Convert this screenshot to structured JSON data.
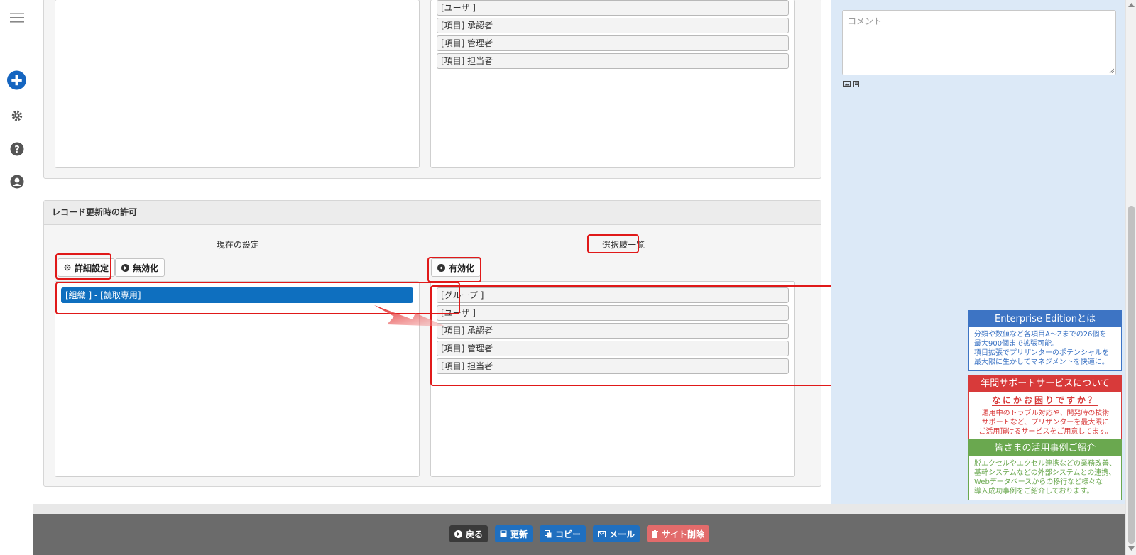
{
  "rail": {
    "icons": [
      "menu-icon",
      "add-icon",
      "gear-icon",
      "help-icon",
      "user-icon"
    ]
  },
  "top_section": {
    "options": [
      "[ユーザ ]",
      "[項目] 承認者",
      "[項目] 管理者",
      "[項目] 担当者"
    ]
  },
  "update_permission": {
    "title": "レコード更新時の許可",
    "current": {
      "heading": "現在の設定",
      "detail_button": "詳細設定",
      "disable_button": "無効化",
      "items": [
        "[組織 ] - [読取専用]"
      ]
    },
    "choices": {
      "heading": "選択肢一覧",
      "enable_button": "有効化",
      "items": [
        "[グループ ]",
        "[ユーザ ]",
        "[項目] 承認者",
        "[項目] 管理者",
        "[項目] 担当者"
      ]
    }
  },
  "side": {
    "comment_placeholder": "コメント",
    "ads": [
      {
        "title": "Enterprise Editionとは",
        "lines": [
          "分類や数値など各項目A～Zまでの26個を",
          "最大900個まで拡張可能。",
          "項目拡張でプリザンターのポテンシャルを",
          "最大限に生かしてマネジメントを快適に。"
        ],
        "color": "#3d74c4"
      },
      {
        "title": "年間サポートサービスについて",
        "subtitle": "なにかお困りですか？",
        "lines": [
          "運用中のトラブル対応や、開発時の技術",
          "サポートなど、プリザンターを最大限に",
          "ご活用頂けるサービスをご用意してます。"
        ],
        "color": "#d83a3a"
      },
      {
        "title": "皆さまの活用事例ご紹介",
        "lines": [
          "脱エクセルやエクセル連携などの業務改善、",
          "基幹システムなどの外部システムとの連携、",
          "Webデータベースからの移行など様々な",
          "導入成功事例をご紹介しております。"
        ],
        "color": "#6aa84f"
      }
    ]
  },
  "bottom": {
    "back": "戻る",
    "update": "更新",
    "copy": "コピー",
    "mail": "メール",
    "delete": "サイト削除"
  }
}
